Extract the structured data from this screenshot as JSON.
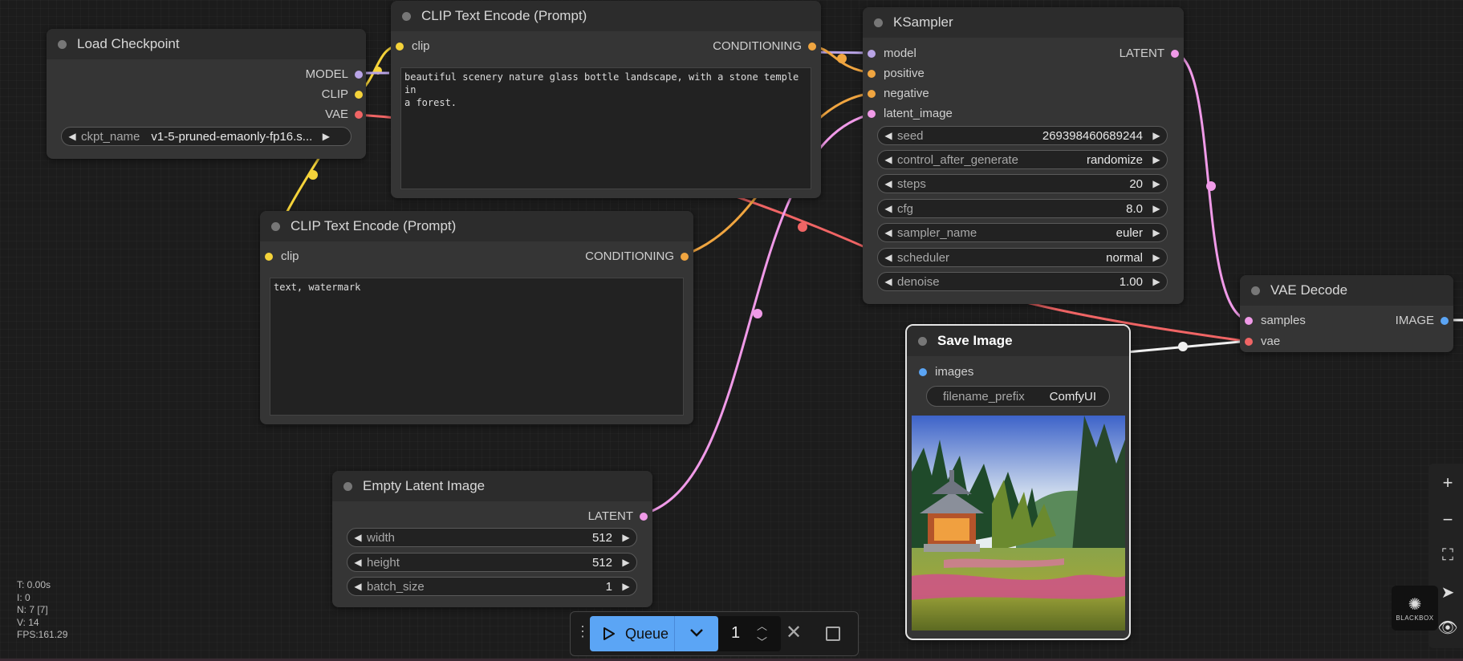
{
  "nodes": {
    "load_checkpoint": {
      "title": "Load Checkpoint",
      "outputs": [
        "MODEL",
        "CLIP",
        "VAE"
      ],
      "ckpt_label": "ckpt_name",
      "ckpt_value": "v1-5-pruned-emaonly-fp16.s..."
    },
    "clip_pos": {
      "title": "CLIP Text Encode (Prompt)",
      "input": "clip",
      "output": "CONDITIONING",
      "text": "beautiful scenery nature glass bottle landscape, with a stone temple in\na forest."
    },
    "clip_neg": {
      "title": "CLIP Text Encode (Prompt)",
      "input": "clip",
      "output": "CONDITIONING",
      "text": "text, watermark"
    },
    "ksampler": {
      "title": "KSampler",
      "inputs": [
        "model",
        "positive",
        "negative",
        "latent_image"
      ],
      "output": "LATENT",
      "widgets": [
        {
          "label": "seed",
          "value": "269398460689244"
        },
        {
          "label": "control_after_generate",
          "value": "randomize"
        },
        {
          "label": "steps",
          "value": "20"
        },
        {
          "label": "cfg",
          "value": "8.0"
        },
        {
          "label": "sampler_name",
          "value": "euler"
        },
        {
          "label": "scheduler",
          "value": "normal"
        },
        {
          "label": "denoise",
          "value": "1.00"
        }
      ]
    },
    "empty_latent": {
      "title": "Empty Latent Image",
      "output": "LATENT",
      "widgets": [
        {
          "label": "width",
          "value": "512"
        },
        {
          "label": "height",
          "value": "512"
        },
        {
          "label": "batch_size",
          "value": "1"
        }
      ]
    },
    "vae_decode": {
      "title": "VAE Decode",
      "inputs": [
        "samples",
        "vae"
      ],
      "output": "IMAGE"
    },
    "save_image": {
      "title": "Save Image",
      "input": "images",
      "prefix_label": "filename_prefix",
      "prefix_value": "ComfyUI"
    }
  },
  "stats": {
    "t": "T: 0.00s",
    "i": "I: 0",
    "n": "N: 7 [7]",
    "v": "V: 14",
    "fps": "FPS:161.29"
  },
  "queue": {
    "label": "Queue",
    "count": "1"
  },
  "watermark": "BLACKBOX",
  "colors": {
    "canvas_bg": "#1c1c1c",
    "node_bg": "#353535",
    "node_title_bg": "#2c2c2c",
    "clip_link": "#f5d33a",
    "model_link": "#b9a4e6",
    "vae_link": "#f06565",
    "conditioning_link": "#f0a540",
    "latent_link": "#f09ae8",
    "image_link": "#5ba5f5",
    "queue_button": "#5ba5f5"
  }
}
